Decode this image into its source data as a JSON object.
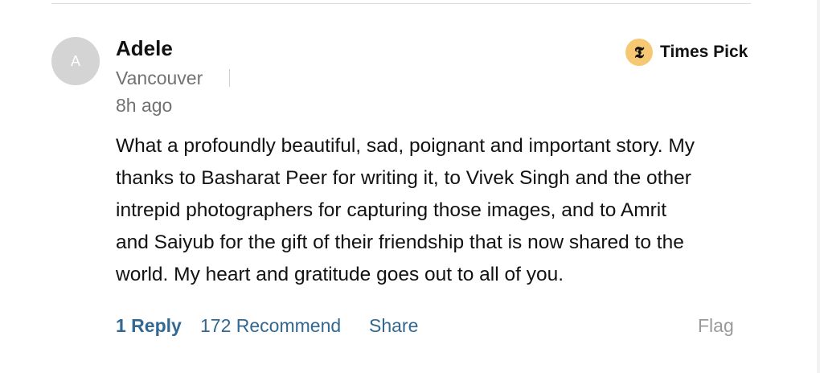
{
  "comment": {
    "author": {
      "name": "Adele",
      "initial": "A",
      "location": "Vancouver"
    },
    "timestamp": "8h ago",
    "badge": {
      "label": "Times Pick",
      "icon": "nyt-t-logo-icon",
      "glyph": "𝕿",
      "color": "#f7c873"
    },
    "body_lines": [
      "What a profoundly beautiful, sad, poignant and important story. My",
      "thanks to Basharat Peer for writing it, to Vivek Singh and the other",
      "intrepid photographers for capturing those images, and to Amrit",
      "and Saiyub for the gift of their friendship that is now shared to the",
      "world. My heart and gratitude goes out to all of you."
    ],
    "actions": {
      "reply": "1 Reply",
      "recommend": "172 Recommend",
      "share": "Share",
      "flag": "Flag"
    }
  },
  "colors": {
    "link": "#326891",
    "muted": "#727272",
    "flag": "#999999",
    "text": "#121212"
  }
}
